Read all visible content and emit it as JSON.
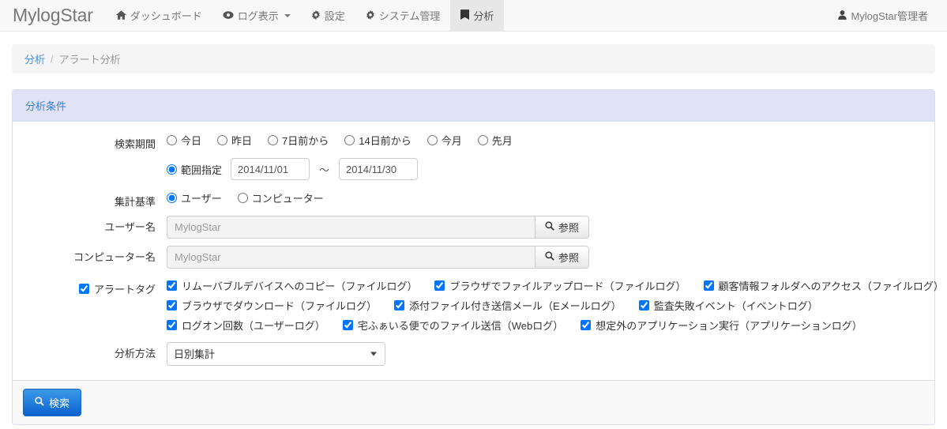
{
  "navbar": {
    "brand": "MylogStar",
    "items": [
      {
        "label": "ダッシュボード",
        "icon": "home-icon",
        "active": false,
        "caret": false
      },
      {
        "label": "ログ表示",
        "icon": "eye-icon",
        "active": false,
        "caret": true
      },
      {
        "label": "設定",
        "icon": "gear-icon",
        "active": false,
        "caret": false
      },
      {
        "label": "システム管理",
        "icon": "gear-icon",
        "active": false,
        "caret": false
      },
      {
        "label": "分析",
        "icon": "book-icon",
        "active": true,
        "caret": false
      }
    ],
    "user": {
      "label": "MylogStar管理者",
      "icon": "user-icon"
    }
  },
  "breadcrumb": {
    "root": "分析",
    "separator": "/",
    "current": "アラート分析"
  },
  "panel": {
    "title": "分析条件"
  },
  "form": {
    "search_period": {
      "label": "検索期間",
      "options": [
        {
          "label": "今日",
          "checked": false
        },
        {
          "label": "昨日",
          "checked": false
        },
        {
          "label": "7日前から",
          "checked": false
        },
        {
          "label": "14日前から",
          "checked": false
        },
        {
          "label": "今月",
          "checked": false
        },
        {
          "label": "先月",
          "checked": false
        }
      ],
      "range": {
        "label": "範囲指定",
        "checked": true,
        "from": "2014/11/01",
        "to": "2014/11/30",
        "separator": "〜"
      }
    },
    "aggregate_basis": {
      "label": "集計基準",
      "options": [
        {
          "label": "ユーザー",
          "checked": true
        },
        {
          "label": "コンピューター",
          "checked": false
        }
      ]
    },
    "user_name": {
      "label": "ユーザー名",
      "value": "MylogStar",
      "button_label": "参照",
      "button_icon": "search-icon"
    },
    "computer_name": {
      "label": "コンピューター名",
      "value": "MylogStar",
      "button_label": "参照",
      "button_icon": "search-icon"
    },
    "alert_tag": {
      "label": "アラートタグ",
      "checked": true,
      "rows": [
        [
          {
            "label": "リムーバブルデバイスへのコピー（ファイルログ）",
            "checked": true
          },
          {
            "label": "ブラウザでファイルアップロード（ファイルログ）",
            "checked": true
          },
          {
            "label": "顧客情報フォルダへのアクセス（ファイルログ）",
            "checked": true
          }
        ],
        [
          {
            "label": "ブラウザでダウンロード（ファイルログ）",
            "checked": true
          },
          {
            "label": "添付ファイル付き送信メール（Eメールログ）",
            "checked": true
          },
          {
            "label": "監査失敗イベント（イベントログ）",
            "checked": true
          }
        ],
        [
          {
            "label": "ログオン回数（ユーザーログ）",
            "checked": true
          },
          {
            "label": "宅ふぁいる便でのファイル送信（Webログ）",
            "checked": true
          },
          {
            "label": "想定外のアプリケーション実行（アプリケーションログ）",
            "checked": true
          }
        ]
      ]
    },
    "analysis_method": {
      "label": "分析方法",
      "selected": "日別集計",
      "options": [
        "日別集計"
      ]
    },
    "submit": {
      "label": "検索",
      "icon": "search-icon"
    }
  },
  "colors": {
    "navbar_bg": "#f8f8f8",
    "panel_header_bg": "#e0e3f5",
    "panel_header_text": "#3b7fd4",
    "link": "#4a90d9",
    "primary_button": "#0a62d0"
  }
}
